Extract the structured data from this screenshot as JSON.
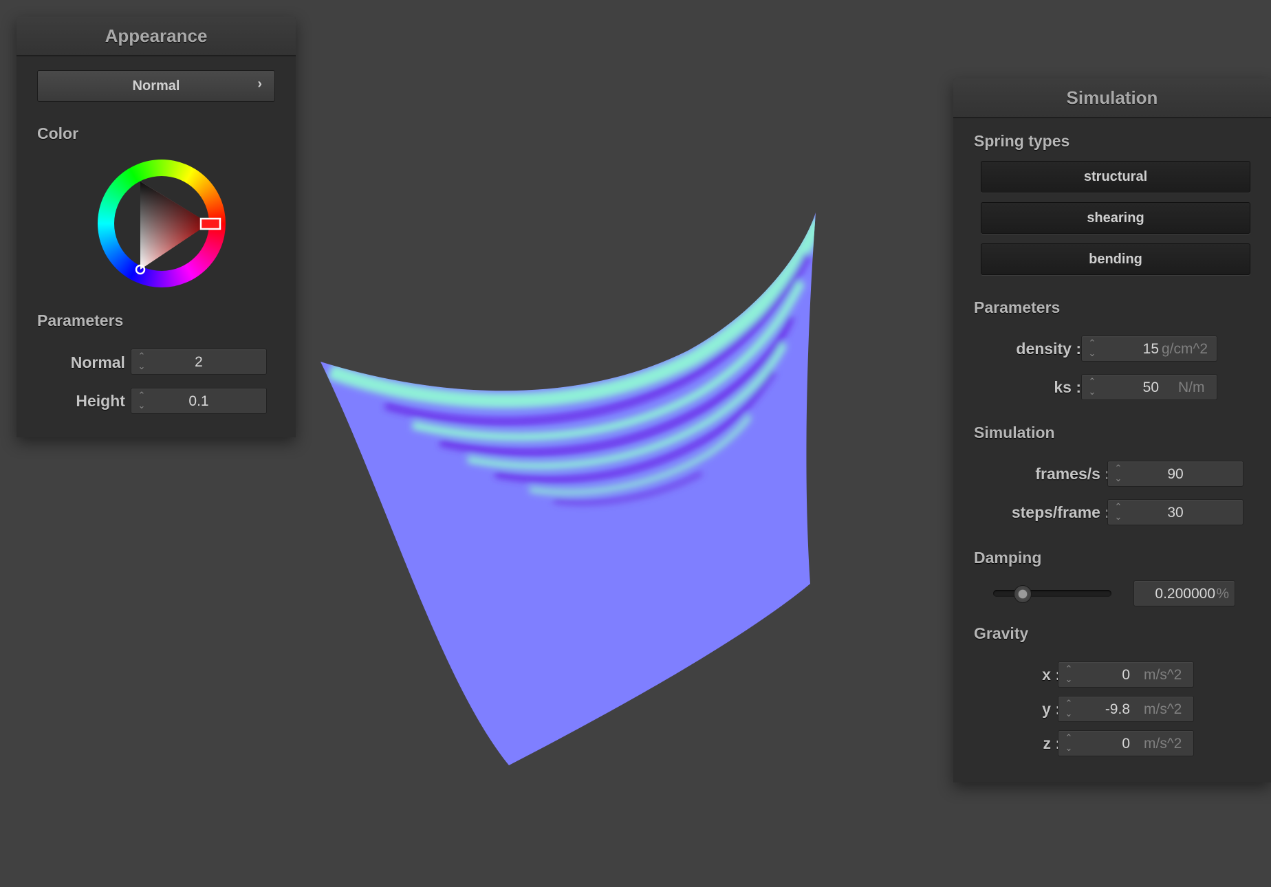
{
  "appearance": {
    "title": "Appearance",
    "shader_select": {
      "label": "Normal",
      "chevron": "chevron-right-icon"
    },
    "color_section": "Color",
    "color_picker": {
      "selected_hue": "#ff0000"
    },
    "parameters_section": "Parameters",
    "normal": {
      "label": "Normal :",
      "value": "2"
    },
    "height": {
      "label": "Height :",
      "value": "0.1"
    }
  },
  "simulation": {
    "title": "Simulation",
    "spring_types_section": "Spring types",
    "spring_buttons": [
      "structural",
      "shearing",
      "bending"
    ],
    "parameters_section": "Parameters",
    "density": {
      "label": "density :",
      "value": "15",
      "unit": "g/cm^2"
    },
    "ks": {
      "label": "ks :",
      "value": "50",
      "unit": "N/m"
    },
    "simulation_section": "Simulation",
    "frames_per_s": {
      "label": "frames/s :",
      "value": "90"
    },
    "steps_per_frame": {
      "label": "steps/frame :",
      "value": "30"
    },
    "damping_section": "Damping",
    "damping": {
      "slider_fraction": 0.2,
      "value": "0.200000",
      "unit": "%"
    },
    "gravity_section": "Gravity",
    "gravity": [
      {
        "label": "x :",
        "value": "0",
        "unit": "m/s^2"
      },
      {
        "label": "y :",
        "value": "-9.8",
        "unit": "m/s^2"
      },
      {
        "label": "z :",
        "value": "0",
        "unit": "m/s^2"
      }
    ]
  },
  "viewport": {
    "cloth_color": "#7f7fff"
  }
}
